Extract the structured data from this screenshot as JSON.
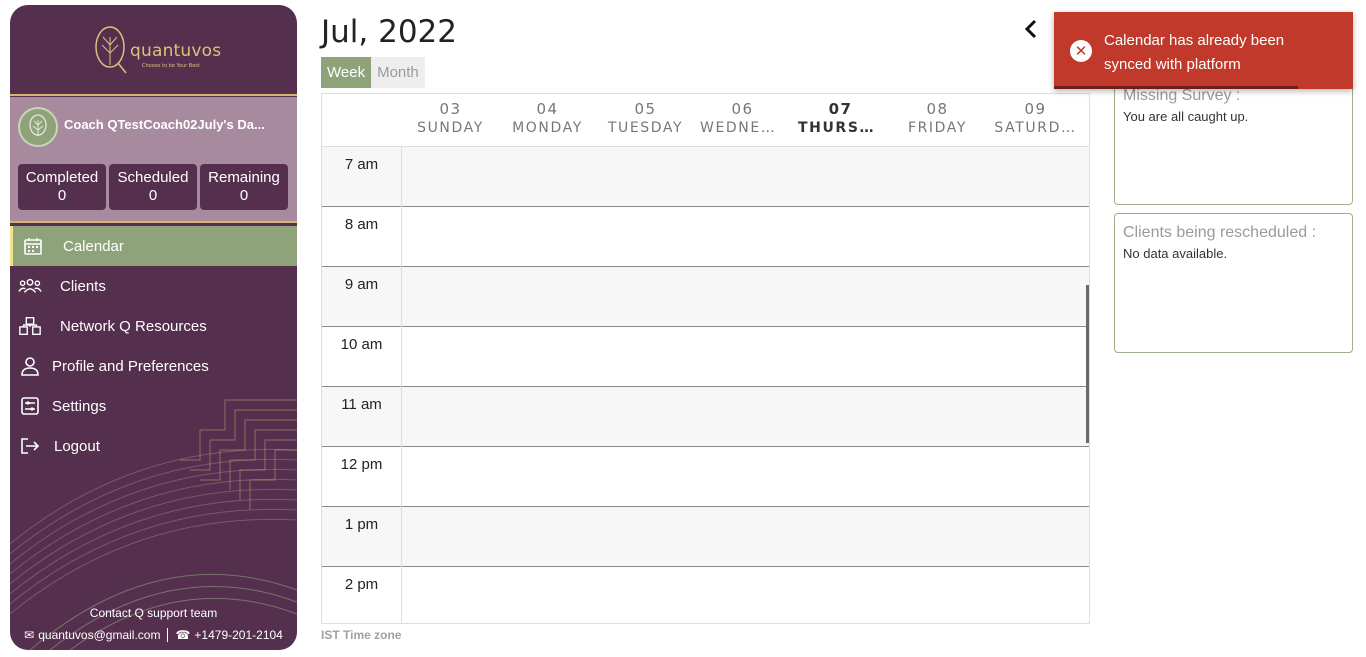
{
  "sidebar": {
    "brand": "quantuvos",
    "tagline": "Choose to be Your Best",
    "coach_name": "Coach QTestCoach02July's Da...",
    "stats": [
      {
        "label": "Completed",
        "value": "0"
      },
      {
        "label": "Scheduled",
        "value": "0"
      },
      {
        "label": "Remaining",
        "value": "0"
      }
    ],
    "nav": [
      {
        "label": "Calendar",
        "icon": "calendar-icon",
        "active": true
      },
      {
        "label": "Clients",
        "icon": "users-icon"
      },
      {
        "label": "Network Q Resources",
        "icon": "network-icon"
      },
      {
        "label": "Profile and Preferences",
        "icon": "user-icon"
      },
      {
        "label": "Settings",
        "icon": "settings-icon"
      },
      {
        "label": "Logout",
        "icon": "logout-icon"
      }
    ],
    "support_title": "Contact Q support team",
    "support_email": "quantuvos@gmail.com",
    "support_phone": "+1479-201-2104"
  },
  "calendar": {
    "month_title": "Jul, 2022",
    "views": {
      "week": "Week",
      "month": "Month"
    },
    "active_view": "Week",
    "days": [
      {
        "num": "03",
        "name": "SUNDAY"
      },
      {
        "num": "04",
        "name": "MONDAY"
      },
      {
        "num": "05",
        "name": "TUESDAY"
      },
      {
        "num": "06",
        "name": "WEDNES…"
      },
      {
        "num": "07",
        "name": "THURSD…",
        "today": true
      },
      {
        "num": "08",
        "name": "FRIDAY"
      },
      {
        "num": "09",
        "name": "SATURD…"
      }
    ],
    "times": [
      "7 am",
      "8 am",
      "9 am",
      "10 am",
      "11 am",
      "12 pm",
      "1 pm",
      "2 pm"
    ],
    "timezone": "IST Time zone"
  },
  "panels": {
    "missing_survey_title": "Missing Survey :",
    "missing_survey_text": "You are all caught up.",
    "rescheduled_title": "Clients being rescheduled :",
    "rescheduled_text": "No data available."
  },
  "toast": {
    "message": "Calendar has already been synced with platform",
    "color": "#c0392b"
  },
  "colors": {
    "sidebar": "#54304e",
    "accent_green": "#8fa37a",
    "gold": "#d9c27a"
  }
}
